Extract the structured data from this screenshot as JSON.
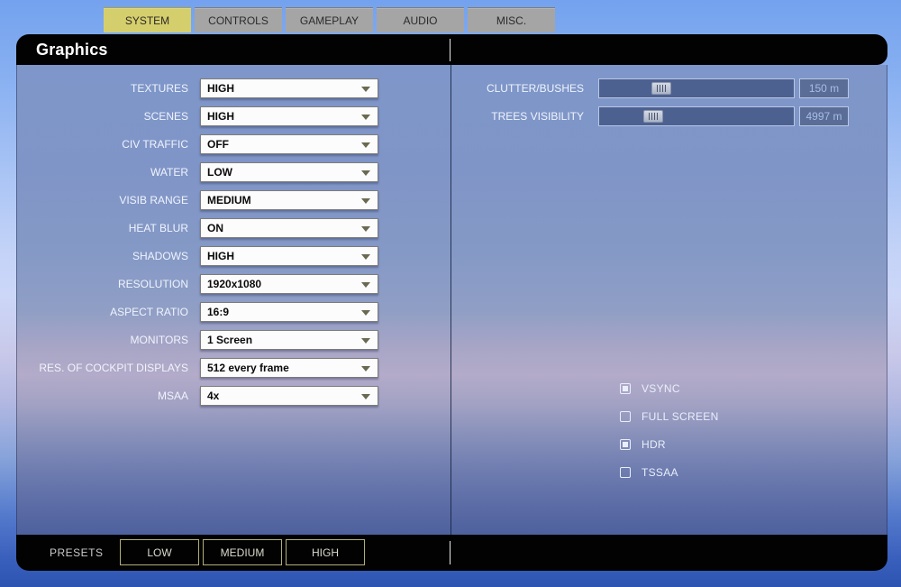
{
  "tabs": [
    {
      "label": "SYSTEM",
      "active": true
    },
    {
      "label": "CONTROLS",
      "active": false
    },
    {
      "label": "GAMEPLAY",
      "active": false
    },
    {
      "label": "AUDIO",
      "active": false
    },
    {
      "label": "MISC.",
      "active": false
    }
  ],
  "panel": {
    "title": "Graphics"
  },
  "dropdowns": [
    {
      "label": "TEXTURES",
      "value": "HIGH"
    },
    {
      "label": "SCENES",
      "value": "HIGH"
    },
    {
      "label": "CIV TRAFFIC",
      "value": "OFF"
    },
    {
      "label": "WATER",
      "value": "LOW"
    },
    {
      "label": "VISIB RANGE",
      "value": "MEDIUM"
    },
    {
      "label": "HEAT BLUR",
      "value": "ON"
    },
    {
      "label": "SHADOWS",
      "value": "HIGH"
    },
    {
      "label": "RESOLUTION",
      "value": "1920x1080"
    },
    {
      "label": "ASPECT RATIO",
      "value": "16:9"
    },
    {
      "label": "MONITORS",
      "value": "1 Screen"
    },
    {
      "label": "RES. OF COCKPIT DISPLAYS",
      "value": "512 every frame"
    },
    {
      "label": "MSAA",
      "value": "4x"
    }
  ],
  "sliders": [
    {
      "label": "CLUTTER/BUSHES",
      "value": "150 m",
      "handle_percent": 32
    },
    {
      "label": "TREES VISIBILITY",
      "value": "4997 m",
      "handle_percent": 28
    }
  ],
  "checkboxes": [
    {
      "label": "VSYNC",
      "checked": true
    },
    {
      "label": "FULL SCREEN",
      "checked": false
    },
    {
      "label": "HDR",
      "checked": true
    },
    {
      "label": "TSSAA",
      "checked": false
    }
  ],
  "presets": {
    "label": "PRESETS",
    "buttons": [
      {
        "label": "LOW"
      },
      {
        "label": "MEDIUM"
      },
      {
        "label": "HIGH"
      }
    ]
  },
  "colors": {
    "active_tab": "#d5ce6c",
    "inactive_tab": "#a5a5a5",
    "bar_black": "#020202",
    "slider_track": "#4d6190",
    "slider_border": "#b9c7e6",
    "value_text": "#a9bce4",
    "label_text": "#f0f4fd",
    "preset_border": "#b2ae7a"
  }
}
